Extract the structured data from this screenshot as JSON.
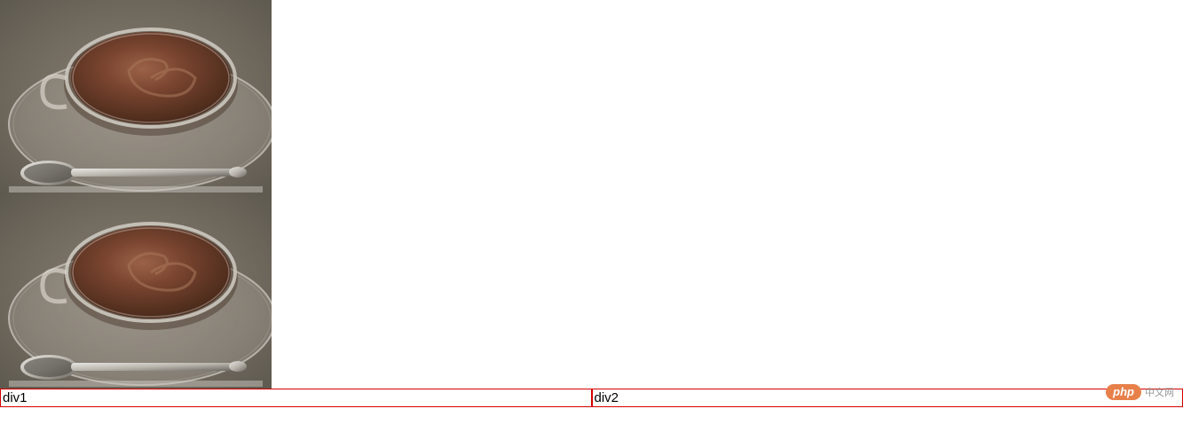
{
  "images": [
    {
      "alt": "coffee-cup-1"
    },
    {
      "alt": "coffee-cup-2"
    }
  ],
  "boxes": [
    {
      "label": "div1"
    },
    {
      "label": "div2"
    }
  ],
  "watermark": {
    "logo": "php",
    "text": "中文网"
  }
}
